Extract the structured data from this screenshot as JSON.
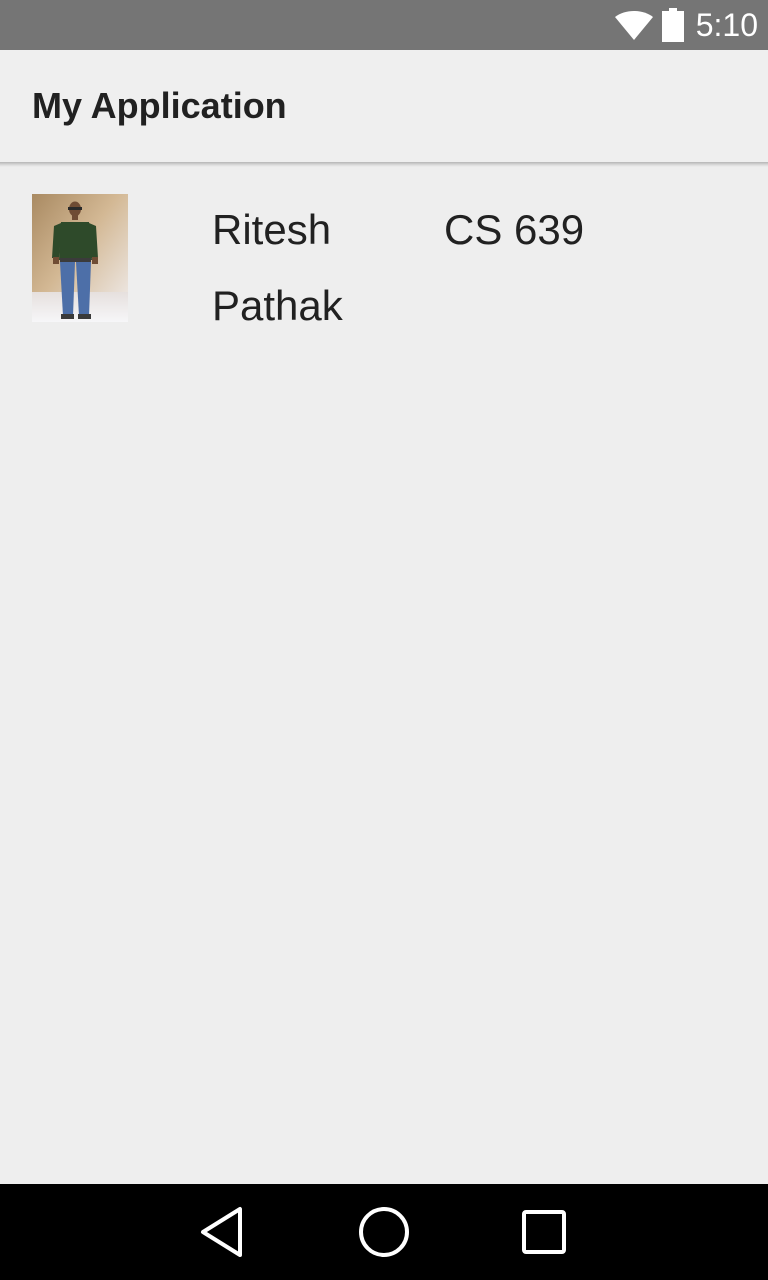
{
  "status_bar": {
    "time": "5:10",
    "icons": [
      "wifi-icon",
      "battery-icon"
    ],
    "background_color": "#757575"
  },
  "action_bar": {
    "title": "My Application"
  },
  "list": {
    "items": [
      {
        "photo": "person-photo",
        "name": "Ritesh Pathak",
        "course": "CS 639"
      }
    ]
  },
  "nav_bar": {
    "buttons": [
      "back-icon",
      "home-icon",
      "recents-icon"
    ]
  }
}
